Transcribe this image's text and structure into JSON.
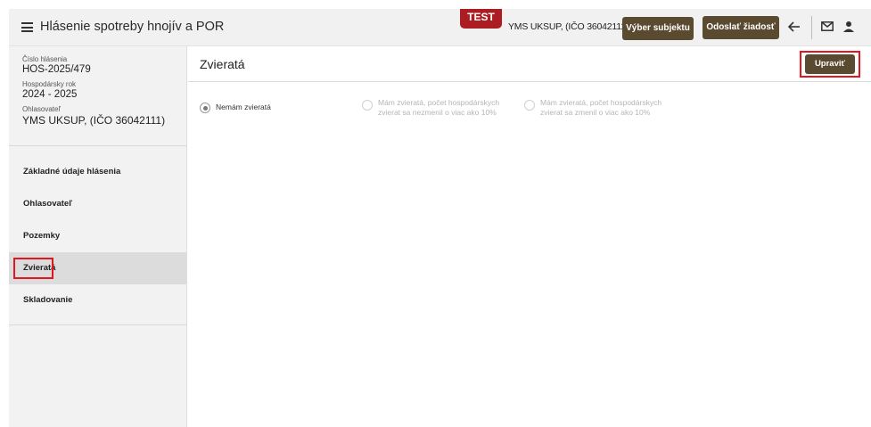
{
  "header": {
    "title": "Hlásenie spotreby hnojív a POR",
    "env_badge": "TEST",
    "subject": "YMS UKSUP, (IČO 36042111)",
    "select_subject_label": "Výber subjektu",
    "send_request_label": "Odoslať žiadosť",
    "icons": [
      "menu-icon",
      "arrow-back-icon",
      "mail-icon",
      "person-icon"
    ]
  },
  "sidebar": {
    "report_number_label": "Číslo hlásenia",
    "report_number": "HOS-2025/479",
    "year_label": "Hospodársky rok",
    "year": "2024 - 2025",
    "reporter_label": "Ohlasovateľ",
    "reporter": "YMS UKSUP, (IČO 36042111)",
    "items": [
      {
        "label": "Základné údaje hlásenia"
      },
      {
        "label": "Ohlasovateľ"
      },
      {
        "label": "Pozemky"
      },
      {
        "label": "Zvieratá"
      },
      {
        "label": "Skladovanie"
      }
    ],
    "active_item": "Zvieratá"
  },
  "main": {
    "title": "Zvieratá",
    "edit_label": "Upraviť",
    "options": [
      {
        "label": "Nemám zvieratá",
        "checked": true,
        "disabled": false
      },
      {
        "line1": "Mám zvieratá, počet hospodárskych",
        "line2": "zvierat sa nezmenil o viac ako 10%",
        "checked": false,
        "disabled": true
      },
      {
        "line1": "Mám zvieratá, počet hospodárskych",
        "line2": "zvierat sa zmenil o viac ako 10%",
        "checked": false,
        "disabled": true
      }
    ]
  },
  "colors": {
    "accent_brown": "#5a4a2f",
    "badge_red": "#ab1d22",
    "highlight_red": "#e3151f"
  }
}
